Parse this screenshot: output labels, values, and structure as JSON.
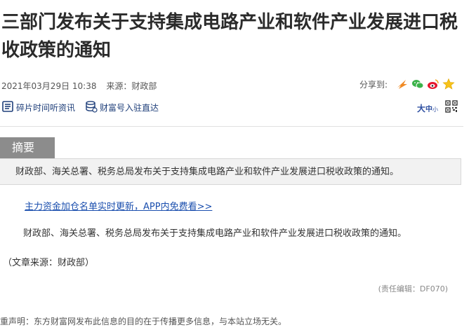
{
  "article": {
    "title": "三部门发布关于支持集成电路产业和软件产业发展进口税收政策的通知",
    "datetime": "2021年03月29日 10:38",
    "source": "来源：财政部",
    "share_label": "分享到:",
    "tools": {
      "listen_label": "碎片时间听资讯",
      "subscribe_label": "财富号入驻直达"
    },
    "font_toggle": {
      "big": "大",
      "mid": "中",
      "small": "小"
    },
    "summary_tab": "摘要",
    "summary_text": "财政部、海关总署、税务总局发布关于支持集成电路产业和软件产业发展进口税收政策的通知。",
    "promo_link": "主力资金加仓名单实时更新，APP内免费看>>",
    "body_text": "财政部、海关总署、税务总局发布关于支持集成电路产业和软件产业发展进口税收政策的通知。",
    "article_source": "（文章来源：财政部）",
    "editor": "(责任编辑：DF070)",
    "disclaimer": "重声明：东方财富网发布此信息的目的在于传播更多信息，与本站立场无关。"
  },
  "colors": {
    "summary_tab_bg": "#8c8c8c",
    "summary_box_bg": "#f2f2f2",
    "link_blue": "#1b4fae",
    "tool_blue": "#1f3f7a"
  },
  "icons": {
    "share": [
      "weibo-arrow-icon",
      "wechat-icon",
      "sina-weibo-icon",
      "favorite-star-icon"
    ],
    "tools": [
      "headphone-list-icon",
      "database-stack-icon"
    ],
    "qr": "qr-code-icon"
  }
}
